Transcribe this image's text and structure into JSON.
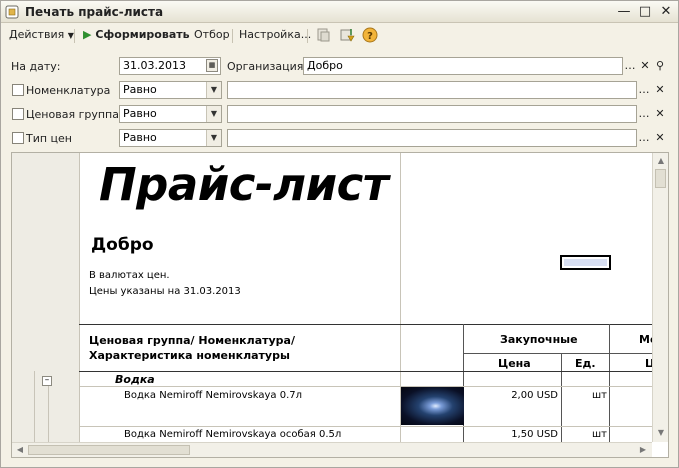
{
  "window": {
    "title": "Печать прайс-листа"
  },
  "toolbar": {
    "actions": "Действия",
    "generate": "Сформировать",
    "filter": "Отбор",
    "settings": "Настройка..."
  },
  "params": {
    "date_label": "На дату:",
    "date_value": "31.03.2013",
    "org_label": "Организация:",
    "org_value": "Добро",
    "rows": [
      {
        "label": "Номенклатура",
        "condition": "Равно",
        "value": ""
      },
      {
        "label": "Ценовая группа",
        "condition": "Равно",
        "value": ""
      },
      {
        "label": "Тип цен",
        "condition": "Равно",
        "value": ""
      }
    ]
  },
  "report": {
    "title": "Прайс-лист",
    "org": "Добро",
    "note1": "В валютах цен.",
    "note2": "Цены указаны на 31.03.2013",
    "col_main": "Ценовая группа/ Номенклатура/ Характеристика номенклатуры",
    "col_purchase": "Закупочные",
    "col_price": "Цена",
    "col_unit": "Ед.",
    "col_next": "Ме",
    "col_next2": "Ц",
    "group": "Водка",
    "items": [
      {
        "name": "Водка Nemiroff Nemirovskaya 0.7л",
        "price": "2,00 USD",
        "unit": "шт"
      },
      {
        "name": "Водка Nemiroff Nemirovskaya особая 0.5л",
        "price": "1,50 USD",
        "unit": "шт"
      }
    ]
  },
  "icons": {
    "app": "document-icon",
    "generate": "play-icon",
    "help": "help-icon"
  }
}
